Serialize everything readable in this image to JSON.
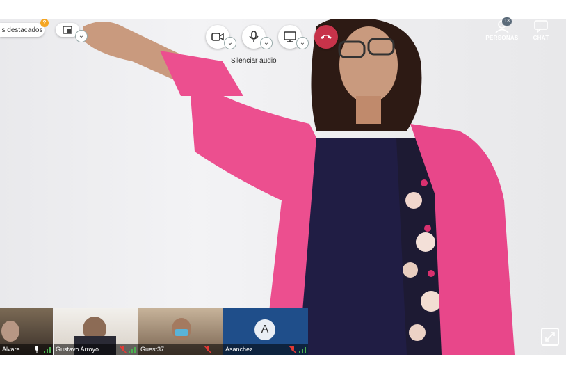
{
  "topbar": {
    "featured_label": "s destacados",
    "featured_badge": "?",
    "camera_icon": "video-camera-icon",
    "mic_icon": "microphone-icon",
    "screen_icon": "screen-share-icon",
    "hangup_icon": "phone-hangup-icon",
    "mic_tooltip": "Silenciar audio",
    "people_label": "PERSONAS",
    "people_count": "13",
    "chat_label": "CHAT"
  },
  "colors": {
    "hangup": "#c7334a",
    "jacket": "#ec4f8f",
    "thumb_active": "#1f4e8a"
  },
  "thumbnails": [
    {
      "name": "Álvare..."
    },
    {
      "name": "Gustavo Arroyo ..."
    },
    {
      "name": "Guest37"
    },
    {
      "name": "Asanchez",
      "avatar": "A"
    }
  ],
  "controls": {
    "fullscreen_icon": "expand-icon"
  }
}
